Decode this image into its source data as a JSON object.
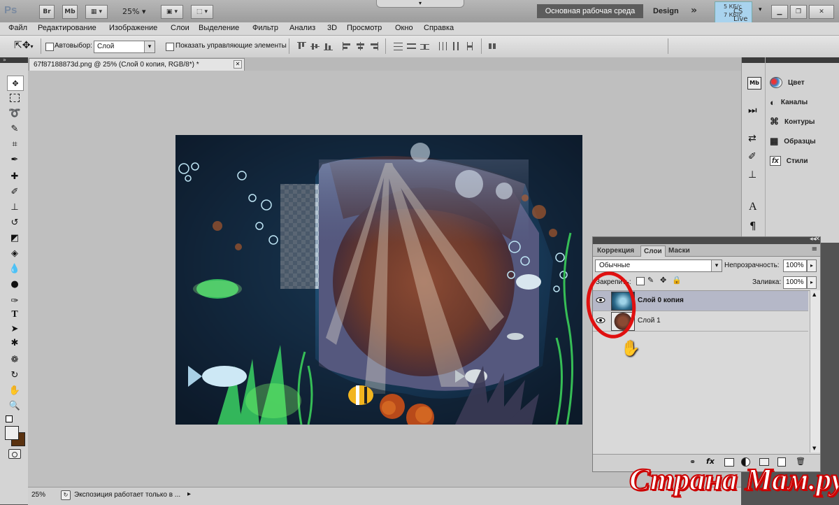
{
  "title_bar": {
    "ps_logo": "Ps",
    "br_label": "Br",
    "mb_label": "Mb",
    "zoom": "25%",
    "workspace_button": "Основная рабочая среда",
    "design_label": "Design",
    "cs_live": "CS Live",
    "speed": "5 КБ/с",
    "speed2": "7 КБ/с"
  },
  "menu": [
    "Файл",
    "Редактирование",
    "Изображение",
    "Слои",
    "Выделение",
    "Фильтр",
    "Анализ",
    "3D",
    "Просмотр",
    "Окно",
    "Справка"
  ],
  "options": {
    "autoselect_label": "Автовыбор:",
    "autoselect_value": "Слой",
    "show_controls_label": "Показать управляющие элементы"
  },
  "document": {
    "tab_title": "67f87188873d.png @ 25% (Слой 0 копия, RGB/8*) *"
  },
  "status": {
    "zoom": "25%",
    "message": "Экспозиция работает только в ..."
  },
  "right_panel": {
    "items": [
      {
        "label": "Цвет",
        "icon": "color-palette-icon"
      },
      {
        "label": "Каналы",
        "icon": "channels-icon"
      },
      {
        "label": "Контуры",
        "icon": "paths-icon"
      },
      {
        "label": "Образцы",
        "icon": "swatches-icon"
      },
      {
        "label": "Стили",
        "icon": "styles-icon"
      }
    ]
  },
  "layers_panel": {
    "tabs": [
      "Коррекция",
      "Слои",
      "Маски"
    ],
    "active_tab": "Слои",
    "blend_mode": "Обычные",
    "opacity_label": "Непрозрачность:",
    "opacity_value": "100%",
    "lock_label": "Закрепить:",
    "fill_label": "Заливка:",
    "fill_value": "100%",
    "layers": [
      {
        "name": "Слой 0 копия",
        "selected": true
      },
      {
        "name": "Слой 1",
        "selected": false
      }
    ]
  },
  "watermark": "Страна Мам.ру",
  "colors": {
    "ui_bg": "#d4d4d4",
    "canvas_bg": "#bfbfbf",
    "selected_layer": "#b5b8c8",
    "highlight_circle": "#e01010"
  }
}
